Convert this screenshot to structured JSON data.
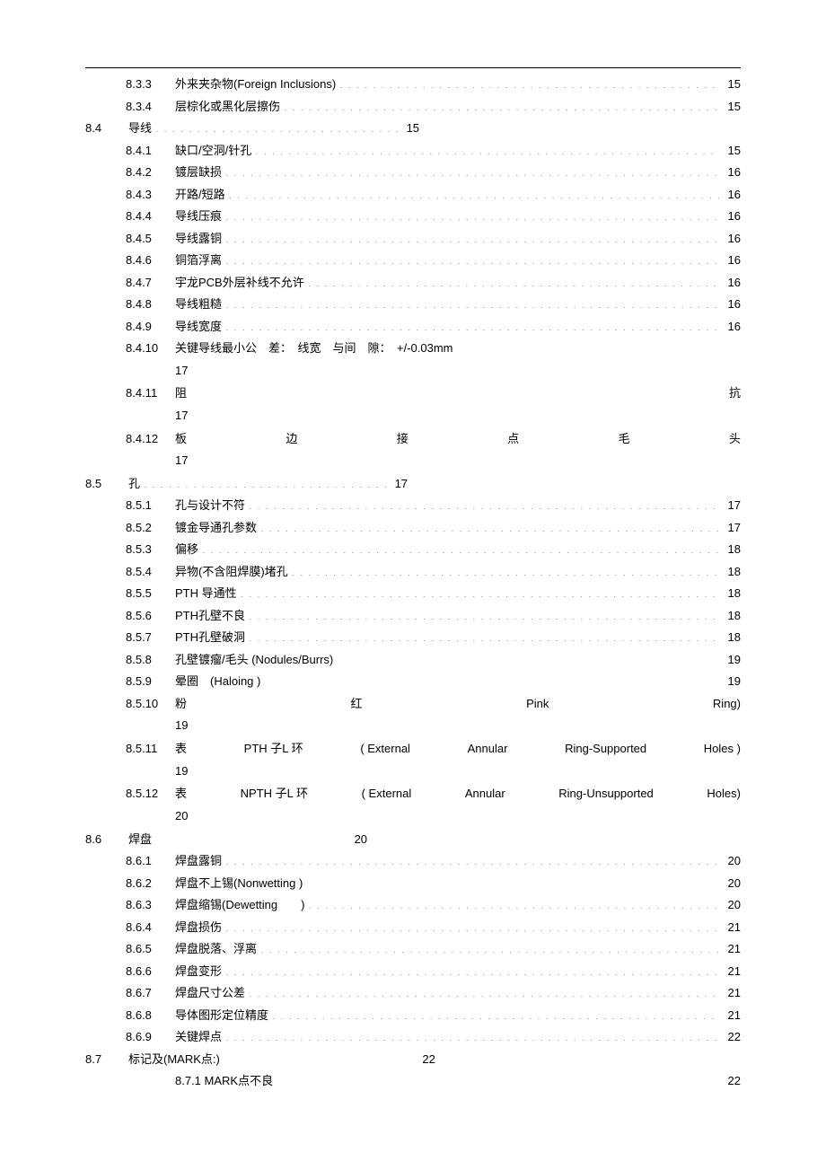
{
  "entries": [
    {
      "kind": "rule"
    },
    {
      "kind": "sub",
      "num": "8.3.3",
      "title": "外来夹杂物(Foreign Inclusions)",
      "page": "15"
    },
    {
      "kind": "sub",
      "num": "8.3.4",
      "title": "层棕化或黑化层擦伤",
      "page": "15"
    },
    {
      "kind": "sec-mid",
      "num": "8.4",
      "title": "导线",
      "page": "15"
    },
    {
      "kind": "sub",
      "num": "8.4.1",
      "title": "缺口/空洞/针孔",
      "page": "15"
    },
    {
      "kind": "sub",
      "num": "8.4.2",
      "title": "镀层缺损",
      "page": "16"
    },
    {
      "kind": "sub",
      "num": "8.4.3",
      "title": "开路/短路",
      "page": "16"
    },
    {
      "kind": "sub",
      "num": "8.4.4",
      "title": "导线压痕",
      "page": "16"
    },
    {
      "kind": "sub",
      "num": "8.4.5",
      "title": "导线露铜",
      "page": "16"
    },
    {
      "kind": "sub",
      "num": "8.4.6",
      "title": "铜箔浮离",
      "page": "16"
    },
    {
      "kind": "sub",
      "num": "8.4.7",
      "title": "宇龙PCB外层补线不允许",
      "page": "16"
    },
    {
      "kind": "sub",
      "num": "8.4.8",
      "title": "导线粗糙",
      "page": "16"
    },
    {
      "kind": "sub",
      "num": "8.4.9",
      "title": "导线宽度",
      "page": "16"
    },
    {
      "kind": "sub-noleader",
      "num": "8.4.10",
      "title": "关键导线最小公　差：　线宽　与间　隙：　+/-0.03mm",
      "page2": "17"
    },
    {
      "kind": "sub-justify2",
      "num": "8.4.11",
      "words": [
        "阻",
        "抗"
      ],
      "page2": "17"
    },
    {
      "kind": "sub-justify2",
      "num": "8.4.12",
      "words": [
        "板",
        "边",
        "接",
        "点",
        "毛",
        "头"
      ],
      "page2": "17"
    },
    {
      "kind": "sec-mid",
      "num": "8.5",
      "title": "孔",
      "page": "17"
    },
    {
      "kind": "sub",
      "num": "8.5.1",
      "title": "孔与设计不符",
      "page": "17"
    },
    {
      "kind": "sub",
      "num": "8.5.2",
      "title": "镀金导通孔参数",
      "page": "17"
    },
    {
      "kind": "sub",
      "num": "8.5.3",
      "title": "偏移",
      "page": "18"
    },
    {
      "kind": "sub",
      "num": "8.5.4",
      "title": "异物(不含阻焊膜)堵孔",
      "page": "18"
    },
    {
      "kind": "sub",
      "num": "8.5.5",
      "title": "PTH 导通性",
      "page": "18"
    },
    {
      "kind": "sub",
      "num": "8.5.6",
      "title": "PTH孔壁不良",
      "page": "18"
    },
    {
      "kind": "sub",
      "num": "8.5.7",
      "title": "PTH孔壁破洞",
      "page": "18"
    },
    {
      "kind": "sub-pageright",
      "num": "8.5.8",
      "title": "孔壁镀瘤/毛头 (Nodules/Burrs)",
      "page": "19"
    },
    {
      "kind": "sub-pageright",
      "num": "8.5.9",
      "title": "晕圈　(Haloing )",
      "page": "19"
    },
    {
      "kind": "sub-justify2",
      "num": "8.5.10",
      "words": [
        "粉",
        "红",
        "Pink",
        "Ring)"
      ],
      "page2": "19"
    },
    {
      "kind": "sub-justify2",
      "num": "8.5.11",
      "words": [
        "表",
        "PTH  子L 环",
        "( External",
        "Annular",
        "Ring-Supported",
        "Holes )"
      ],
      "page2": "19"
    },
    {
      "kind": "sub-justify2",
      "num": "8.5.12",
      "words": [
        "表",
        "NPTH  子L 环",
        "( External",
        "Annular",
        "Ring-Unsupported",
        "Holes)"
      ],
      "page2": "20"
    },
    {
      "kind": "sec-pad",
      "num": "8.6",
      "title": "焊盘",
      "page": "20"
    },
    {
      "kind": "sub",
      "num": "8.6.1",
      "title": "焊盘露铜",
      "page": "20"
    },
    {
      "kind": "sub-pageright",
      "num": "8.6.2",
      "title": "焊盘不上锡(Nonwetting )",
      "page": "20"
    },
    {
      "kind": "sub-leader-gap",
      "num": "8.6.3",
      "title": "焊盘缩锡(Dewetting　　)",
      "page": "20"
    },
    {
      "kind": "sub",
      "num": "8.6.4",
      "title": "焊盘损伤",
      "page": "21"
    },
    {
      "kind": "sub",
      "num": "8.6.5",
      "title": "焊盘脱落、浮离",
      "page": "21"
    },
    {
      "kind": "sub",
      "num": "8.6.6",
      "title": "焊盘变形",
      "page": "21"
    },
    {
      "kind": "sub",
      "num": "8.6.7",
      "title": "焊盘尺寸公差",
      "page": "21"
    },
    {
      "kind": "sub",
      "num": "8.6.8",
      "title": "导体图形定位精度",
      "page": "21"
    },
    {
      "kind": "sub",
      "num": "8.6.9",
      "title": "关键焊点",
      "page": "22"
    },
    {
      "kind": "sec-pad",
      "num": "8.7",
      "title": "标记及(MARK点:)",
      "page": "22"
    },
    {
      "kind": "sub-pageright-tight",
      "num": "",
      "title": "8.7.1 MARK点不良",
      "page": "22"
    }
  ]
}
